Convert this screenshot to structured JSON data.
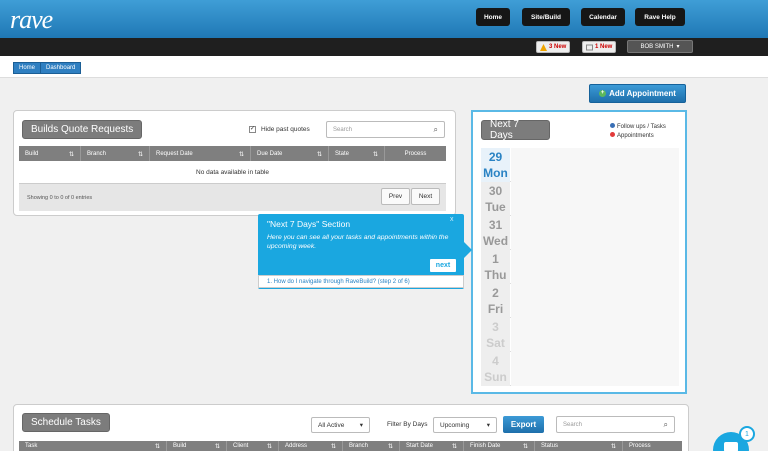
{
  "header": {
    "logo": "rave",
    "nav": [
      {
        "label": "Home"
      },
      {
        "label": "Site/Build"
      },
      {
        "label": "Calendar"
      },
      {
        "label": "Rave Help"
      }
    ]
  },
  "topbar": {
    "alert1": "3 New",
    "alert2": "1 New",
    "user": "BOB SMITH"
  },
  "breadcrumb": [
    "Home",
    "Dashboard"
  ],
  "add_appointment": "Add Appointment",
  "builds": {
    "title": "Builds Quote Requests",
    "hide_past": "Hide past quotes",
    "search_placeholder": "Search",
    "columns": [
      "Build",
      "Branch",
      "Request Date",
      "Due Date",
      "State",
      "Process"
    ],
    "empty": "No data available in table",
    "info": "Showing 0 to 0 of 0 entries",
    "prev": "Prev",
    "next": "Next"
  },
  "next7": {
    "title": "Next 7 Days",
    "legend": [
      {
        "label": "Follow ups / Tasks",
        "color": "#3a6fb5"
      },
      {
        "label": "Appointments",
        "color": "#e23a3a"
      }
    ],
    "days": [
      {
        "num": "29",
        "name": "Mon"
      },
      {
        "num": "30",
        "name": "Tue"
      },
      {
        "num": "31",
        "name": "Wed"
      },
      {
        "num": "1",
        "name": "Thu"
      },
      {
        "num": "2",
        "name": "Fri"
      },
      {
        "num": "3",
        "name": "Sat"
      },
      {
        "num": "4",
        "name": "Sun"
      }
    ]
  },
  "tooltip": {
    "title": "\"Next 7 Days\" Section",
    "body": "Here you can see all your tasks and appointments within the upcoming week.",
    "next": "next",
    "close": "x",
    "footer": "1. How do I navigate through RaveBuild? (step 2 of 6)"
  },
  "schedule": {
    "title": "Schedule Tasks",
    "filter_active": "All Active",
    "filter_label": "Filter By Days",
    "filter_value": "Upcoming",
    "export": "Export",
    "search_placeholder": "Search",
    "columns": [
      "Task",
      "Build",
      "Client",
      "Address",
      "Branch",
      "Start Date",
      "Finish Date",
      "Status",
      "Process"
    ]
  },
  "fab": {
    "badge": "1"
  }
}
